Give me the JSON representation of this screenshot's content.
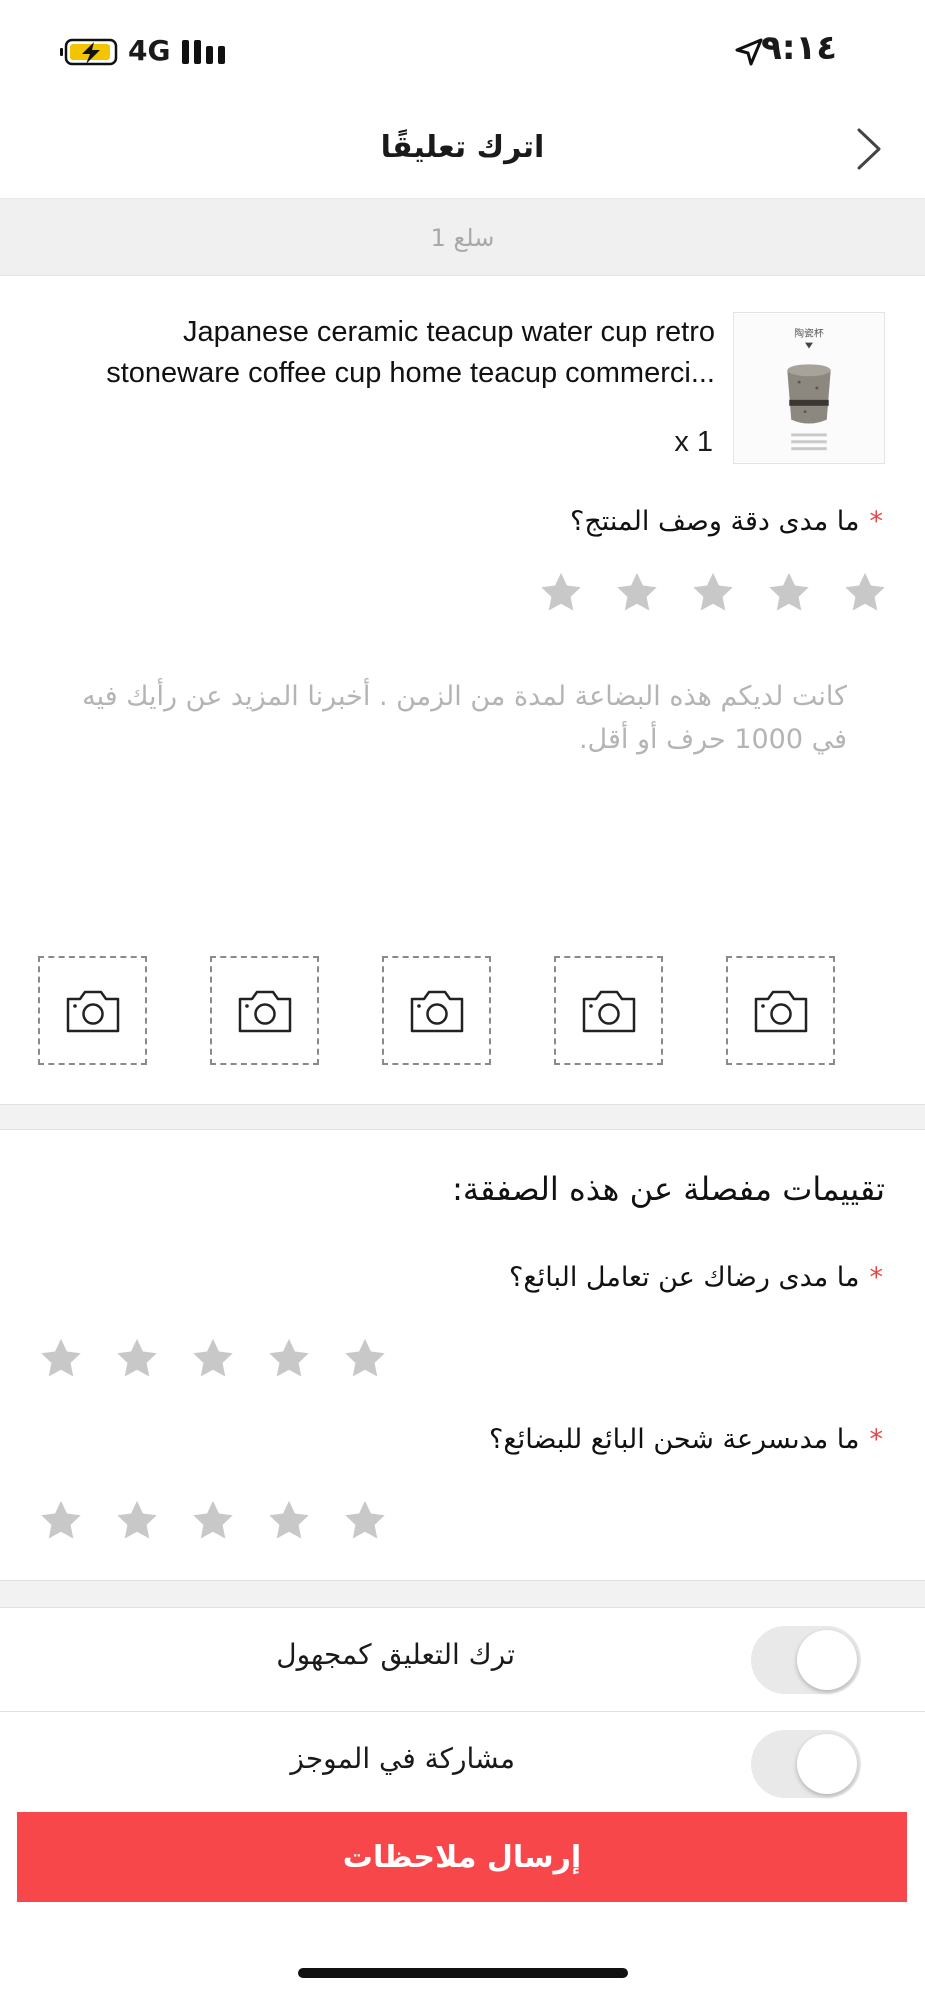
{
  "status_bar": {
    "network": "4G",
    "time": "٩:١٤"
  },
  "nav": {
    "title": "اترك تعليقًا"
  },
  "count_band": {
    "text": "1 سلع"
  },
  "product": {
    "title_line1": "Japanese ceramic teacup water cup retro",
    "title_line2": "stoneware coffee cup home teacup commerci...",
    "quantity": "x 1",
    "image_caption": "陶瓷杯"
  },
  "accuracy_question": {
    "required_mark": "*",
    "label": "ما مدى دقة وصف المنتج؟",
    "rating": 0,
    "max": 5
  },
  "review": {
    "placeholder": "كانت لديكم هذه البضاعة لمدة من الزمن . أخبرنا المزيد عن رأيك فيه في 1000 حرف أو أقل."
  },
  "photos": {
    "slots": 5
  },
  "detailed": {
    "title": "تقييمات مفصلة عن هذه الصفقة:",
    "seller_question": {
      "required_mark": "*",
      "label": "ما مدى رضاك عن تعامل البائع؟",
      "rating": 0,
      "max": 5
    },
    "shipping_question": {
      "required_mark": "*",
      "label": "ما مدىسرعة شحن البائع للبضائع؟",
      "rating": 0,
      "max": 5
    }
  },
  "toggles": [
    {
      "label": "ترك التعليق كمجهول",
      "on": false
    },
    {
      "label": "مشاركة في الموجز",
      "on": false
    }
  ],
  "submit": {
    "label": "إرسال ملاحظات"
  },
  "colors": {
    "accent": "#f8474a",
    "required": "#e84646",
    "star_empty": "#c8c8c8",
    "band": "#f2f2f2"
  }
}
